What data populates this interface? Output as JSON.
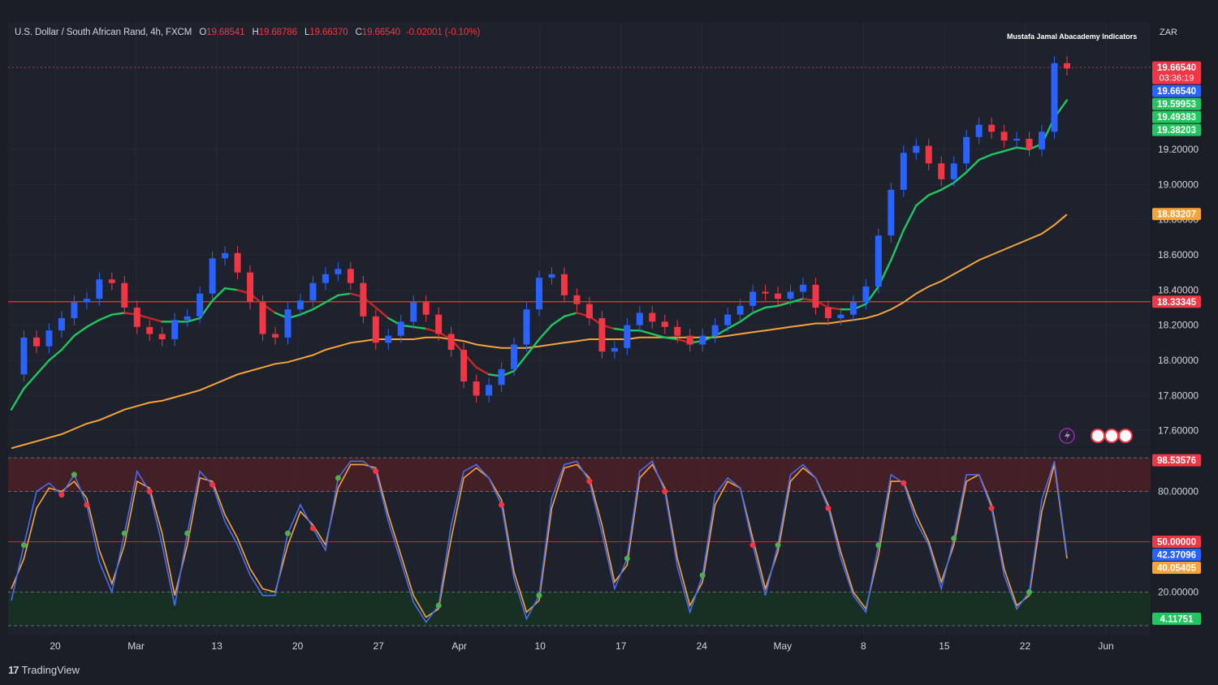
{
  "header": {
    "symbol": "U.S. Dollar / South African Rand, 4h, FXCM",
    "open_label": "O",
    "open": "19.68541",
    "high_label": "H",
    "high": "19.68786",
    "low_label": "L",
    "low": "19.66370",
    "close_label": "C",
    "close": "19.66540",
    "change": "-0.02001 (-0.10%)",
    "indicator_title": "Mustafa Jamal Abacademy Indicators",
    "currency": "ZAR"
  },
  "branding": {
    "logo_text": "TradingView",
    "logo_mark": "17"
  },
  "colors": {
    "background": "#1b1e27",
    "panel": "#1e222d",
    "up_candle": "#2962ff",
    "down_candle": "#f23645",
    "ema_fast": "#22c55e",
    "ema_fast_down": "#c62828",
    "ema_slow": "#f7a33a",
    "horizontal_line": "#f23645",
    "stoch_k": "#4a6cf0",
    "stoch_d": "#f7a33a",
    "overbought_zone": "#4a1e26",
    "oversold_zone": "#163322"
  },
  "chart_data": [
    {
      "type": "line",
      "panel": "price",
      "x_ticks": [
        "20",
        "Mar",
        "13",
        "20",
        "27",
        "Apr",
        "10",
        "17",
        "24",
        "May",
        "8",
        "15",
        "22",
        "Jun"
      ],
      "y_ticks": [
        "17.60000",
        "17.80000",
        "18.00000",
        "18.20000",
        "18.40000",
        "18.60000",
        "18.80000",
        "19.00000",
        "19.20000"
      ],
      "ylim": [
        17.52,
        19.92
      ],
      "series": [
        {
          "role": "close",
          "values": [
            17.92,
            18.13,
            18.08,
            18.17,
            18.24,
            18.33,
            18.35,
            18.46,
            18.44,
            18.3,
            18.19,
            18.15,
            18.12,
            18.23,
            18.25,
            18.38,
            18.58,
            18.61,
            18.5,
            18.33,
            18.15,
            18.13,
            18.29,
            18.34,
            18.44,
            18.49,
            18.52,
            18.44,
            18.25,
            18.1,
            18.14,
            18.22,
            18.33,
            18.26,
            18.15,
            18.06,
            17.88,
            17.8,
            17.86,
            17.95,
            18.09,
            18.29,
            18.47,
            18.49,
            18.37,
            18.32,
            18.24,
            18.05,
            18.07,
            18.2,
            18.27,
            18.22,
            18.19,
            18.14,
            18.09,
            18.14,
            18.2,
            18.26,
            18.31,
            18.39,
            18.38,
            18.35,
            18.39,
            18.43,
            18.3,
            18.24,
            18.26,
            18.33,
            18.42,
            18.71,
            18.97,
            19.18,
            19.22,
            19.12,
            19.03,
            19.12,
            19.27,
            19.34,
            19.3,
            19.25,
            19.26,
            19.2,
            19.3,
            19.69,
            19.66
          ]
        },
        {
          "role": "ema_fast",
          "values": [
            17.72,
            17.84,
            17.92,
            18.0,
            18.06,
            18.14,
            18.19,
            18.23,
            18.26,
            18.27,
            18.26,
            18.24,
            18.22,
            18.22,
            18.22,
            18.24,
            18.34,
            18.41,
            18.4,
            18.38,
            18.32,
            18.27,
            18.24,
            18.26,
            18.29,
            18.33,
            18.37,
            18.38,
            18.36,
            18.3,
            18.24,
            18.2,
            18.19,
            18.18,
            18.16,
            18.12,
            18.04,
            17.96,
            17.92,
            17.91,
            17.94,
            18.03,
            18.12,
            18.2,
            18.25,
            18.27,
            18.25,
            18.2,
            18.18,
            18.17,
            18.17,
            18.15,
            18.13,
            18.12,
            18.1,
            18.11,
            18.14,
            18.18,
            18.22,
            18.27,
            18.3,
            18.31,
            18.33,
            18.35,
            18.34,
            18.3,
            18.29,
            18.29,
            18.32,
            18.42,
            18.57,
            18.74,
            18.88,
            18.94,
            18.97,
            19.01,
            19.07,
            19.14,
            19.17,
            19.19,
            19.21,
            19.2,
            19.23,
            19.38,
            19.48
          ]
        },
        {
          "role": "ema_slow",
          "values": [
            17.5,
            17.52,
            17.54,
            17.56,
            17.58,
            17.61,
            17.64,
            17.66,
            17.69,
            17.72,
            17.74,
            17.76,
            17.77,
            17.79,
            17.81,
            17.83,
            17.86,
            17.89,
            17.92,
            17.94,
            17.96,
            17.98,
            17.99,
            18.01,
            18.03,
            18.06,
            18.08,
            18.1,
            18.11,
            18.12,
            18.12,
            18.12,
            18.12,
            18.13,
            18.13,
            18.12,
            18.11,
            18.09,
            18.08,
            18.07,
            18.07,
            18.07,
            18.08,
            18.09,
            18.1,
            18.11,
            18.12,
            18.12,
            18.12,
            18.12,
            18.13,
            18.13,
            18.13,
            18.13,
            18.13,
            18.13,
            18.13,
            18.14,
            18.15,
            18.16,
            18.17,
            18.18,
            18.19,
            18.2,
            18.21,
            18.21,
            18.22,
            18.23,
            18.24,
            18.26,
            18.29,
            18.33,
            18.38,
            18.42,
            18.45,
            18.49,
            18.53,
            18.57,
            18.6,
            18.63,
            18.66,
            18.69,
            18.72,
            18.77,
            18.83
          ]
        }
      ],
      "horizontal_line": 18.33345,
      "price_labels": [
        {
          "text": "19.66540",
          "sub": "03:36:19",
          "value": 19.6654,
          "color": "#f23645"
        },
        {
          "text": "19.66540",
          "value": 19.6654,
          "color": "#2962ff"
        },
        {
          "text": "19.59953",
          "value": 19.59953,
          "color": "#22c55e"
        },
        {
          "text": "19.49383",
          "value": 19.49383,
          "color": "#22c55e"
        },
        {
          "text": "19.38203",
          "value": 19.38203,
          "color": "#22c55e"
        },
        {
          "text": "18.83207",
          "value": 18.83207,
          "color": "#f7a33a"
        },
        {
          "text": "18.33345",
          "value": 18.33345,
          "color": "#f23645"
        }
      ]
    },
    {
      "type": "line",
      "panel": "stochastic",
      "y_ticks": [
        "20.00000",
        "80.00000"
      ],
      "ylim": [
        -2,
        102
      ],
      "levels": [
        0,
        20,
        50,
        80,
        100
      ],
      "series": [
        {
          "role": "k",
          "values": [
            15,
            48,
            80,
            85,
            78,
            90,
            72,
            38,
            20,
            55,
            92,
            80,
            48,
            12,
            55,
            92,
            84,
            62,
            48,
            30,
            18,
            18,
            55,
            72,
            58,
            45,
            88,
            98,
            98,
            92,
            62,
            38,
            14,
            2,
            12,
            60,
            92,
            96,
            88,
            72,
            28,
            4,
            18,
            76,
            96,
            98,
            86,
            55,
            22,
            40,
            92,
            98,
            80,
            35,
            8,
            30,
            78,
            88,
            82,
            48,
            18,
            48,
            90,
            96,
            88,
            70,
            40,
            18,
            8,
            48,
            90,
            85,
            62,
            48,
            22,
            52,
            90,
            90,
            70,
            30,
            10,
            20,
            75,
            98,
            42
          ]
        },
        {
          "role": "d",
          "values": [
            22,
            40,
            70,
            82,
            80,
            86,
            76,
            45,
            25,
            48,
            86,
            82,
            55,
            18,
            48,
            88,
            86,
            66,
            52,
            34,
            22,
            20,
            48,
            68,
            60,
            48,
            82,
            96,
            96,
            94,
            66,
            42,
            18,
            5,
            10,
            52,
            88,
            94,
            88,
            75,
            32,
            8,
            15,
            70,
            94,
            96,
            88,
            60,
            26,
            36,
            88,
            96,
            82,
            40,
            12,
            26,
            72,
            86,
            82,
            52,
            22,
            44,
            86,
            94,
            88,
            72,
            44,
            20,
            10,
            42,
            86,
            86,
            66,
            50,
            26,
            48,
            86,
            90,
            72,
            34,
            12,
            18,
            68,
            96,
            40
          ]
        }
      ],
      "value_labels": [
        {
          "text": "98.53576",
          "value": 98.53576,
          "color": "#f23645"
        },
        {
          "text": "50.00000",
          "value": 50.0,
          "color": "#f23645"
        },
        {
          "text": "42.37096",
          "value": 42.37096,
          "color": "#2962ff"
        },
        {
          "text": "40.05405",
          "value": 40.05405,
          "color": "#f7a33a"
        },
        {
          "text": "4.11751",
          "value": 4.11751,
          "color": "#22c55e"
        }
      ]
    }
  ]
}
